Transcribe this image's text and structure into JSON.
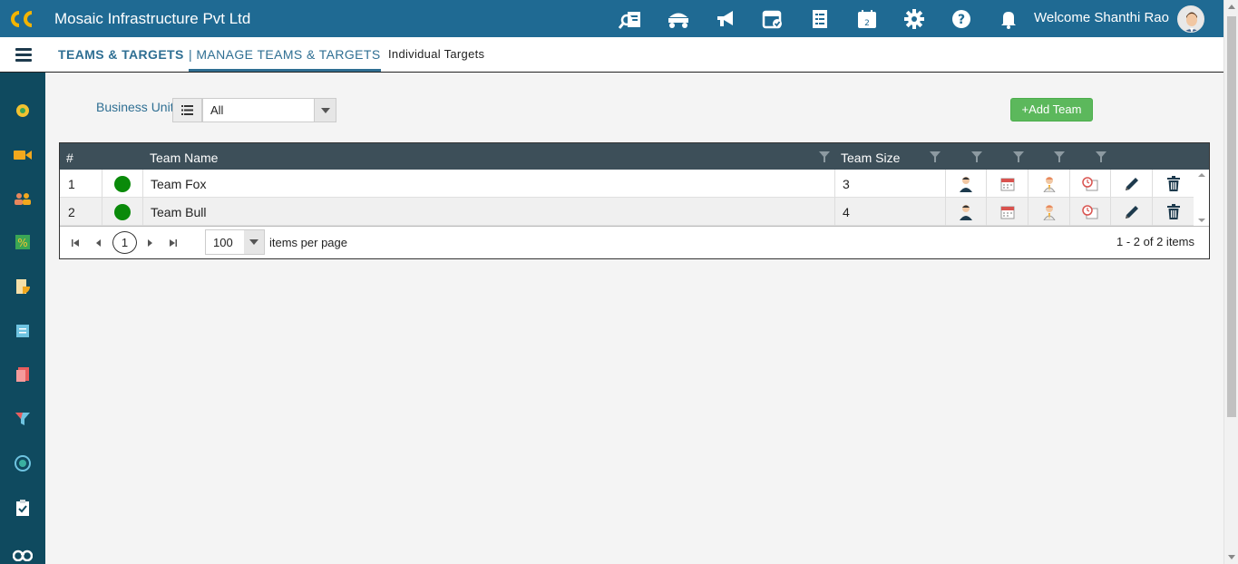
{
  "header": {
    "company": "Mosaic Infrastructure Pvt Ltd",
    "welcome": "Welcome Shanthi Rao",
    "icons": [
      "search-report-icon",
      "truck-icon",
      "megaphone-icon",
      "calendar-check-icon",
      "checklist-icon",
      "calendar-icon",
      "gear-icon",
      "help-icon",
      "bell-icon"
    ]
  },
  "subnav": {
    "tab1": "TEAMS & TARGETS",
    "tab2": "| MANAGE TEAMS & TARGETS",
    "tab3": "Individual Targets"
  },
  "filters": {
    "business_unit_label": "Business Unit",
    "business_unit_value": "All",
    "add_team_label": "+Add Team"
  },
  "grid": {
    "columns": [
      "#",
      "",
      "Team Name",
      "Team Size"
    ],
    "rows": [
      {
        "num": "1",
        "name": "Team Fox",
        "size": "3",
        "status_color": "#0a8a0a"
      },
      {
        "num": "2",
        "name": "Team Bull",
        "size": "4",
        "status_color": "#0a8a0a"
      }
    ]
  },
  "pager": {
    "current_page": "1",
    "page_size": "100",
    "per_page_text": "items per page",
    "info": "1 - 2 of 2 items"
  },
  "colors": {
    "topbar": "#1f6a93",
    "sidebar": "#0f4a5f",
    "grid_header": "#3d4f59",
    "add_button": "#5cb85c",
    "status_active": "#0a8a0a"
  }
}
